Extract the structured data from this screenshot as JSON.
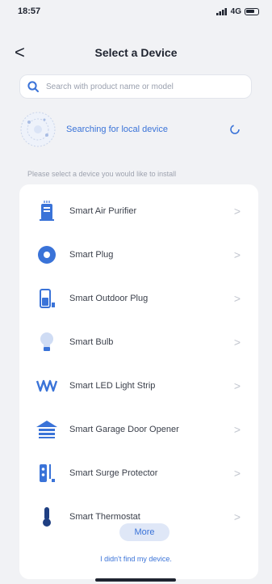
{
  "status_bar": {
    "time": "18:57",
    "signal": "4G"
  },
  "nav": {
    "back_glyph": "<",
    "title": "Select a Device"
  },
  "search": {
    "placeholder": "Search with product name or model"
  },
  "scan": {
    "label": "Searching for local device"
  },
  "hint": "Please select a device you would like to install",
  "devices": [
    {
      "label": "Smart Air Purifier",
      "icon": "air-purifier-icon"
    },
    {
      "label": "Smart Plug",
      "icon": "plug-icon"
    },
    {
      "label": "Smart Outdoor Plug",
      "icon": "outdoor-plug-icon"
    },
    {
      "label": "Smart Bulb",
      "icon": "bulb-icon"
    },
    {
      "label": "Smart LED Light Strip",
      "icon": "led-strip-icon"
    },
    {
      "label": "Smart Garage Door Opener",
      "icon": "garage-door-icon"
    },
    {
      "label": "Smart Surge Protector",
      "icon": "surge-protector-icon"
    },
    {
      "label": "Smart Thermostat",
      "icon": "thermostat-icon"
    }
  ],
  "chevron_glyph": ">",
  "more_button": "More",
  "not_found": "I didn't find my device.",
  "colors": {
    "accent": "#3a73d8",
    "background": "#f1f2f5",
    "card": "#ffffff"
  }
}
